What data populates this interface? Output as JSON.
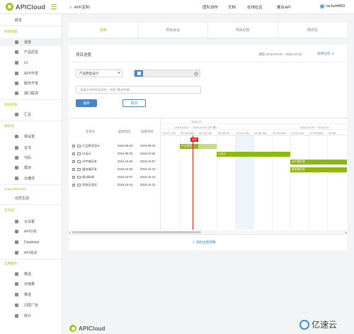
{
  "topbar": {
    "logo_text": "APICloud",
    "chevron": "∨",
    "app_title": "APP定制",
    "nav": [
      "团队协作",
      "文档",
      "在线社区",
      "聚合API"
    ],
    "username": "rachel4869"
  },
  "sidebar": {
    "overview": "概览",
    "sections": [
      {
        "title": "项目管理",
        "items": [
          "进度",
          "产品原型",
          "UI",
          "APP开发",
          "服务开发",
          "接口联调"
        ]
      },
      {
        "title": "测试验收",
        "items": [
          "汇总"
        ]
      },
      {
        "title": "端开发",
        "items": [
          "端设置",
          "证书",
          "代码",
          "模块",
          "云编译"
        ]
      },
      {
        "title": "SuperWebView",
        "items": [
          "动态生成"
        ]
      },
      {
        "title": "云开发",
        "items": [
          "云设置",
          "API分析",
          "Database",
          "API测试"
        ]
      },
      {
        "title": "应用服务",
        "items": [
          "推送",
          "云储量",
          "推送",
          "闪屏广告",
          "统计"
        ]
      }
    ]
  },
  "tabs": [
    {
      "label": "进度",
      "active": true
    },
    {
      "label": "项目会议",
      "active": false
    },
    {
      "label": "项目动态",
      "active": false
    },
    {
      "label": "预评估",
      "active": false
    }
  ],
  "panel": {
    "title": "项目进度",
    "date_range": "进程 2016-09-20 ~ 2016-10-22",
    "new_task": "新建任务",
    "stage_select": "产品原型设计",
    "desc_placeholder": "请填写你的阶段说明，例如 \"需求完善\"",
    "save": "保存",
    "cancel": "取消",
    "collapse": "∨ 收起进度明细"
  },
  "gantt": {
    "headers": {
      "name": "任务名",
      "start": "起始时间",
      "end": "结束时间"
    },
    "year_month": "2016-09",
    "week_range": "2016-09-27 ~ 2016-10-03 (39 周)",
    "week_range_right": "2016-10-03 ~ 2016-10-",
    "days": [
      "09-27,Tue",
      "09-28,Wed",
      "09-29,Thu",
      "09-30,Fri",
      "10-01,Sat",
      "10-02,Sun",
      "10-03,Mon",
      "10-04,Tue",
      "10-05,Wed",
      "10-06"
    ],
    "today_label": "今天",
    "tasks": [
      {
        "name": "产品原型设计",
        "start": "2016-09-20",
        "end": "2016-09-30",
        "bar_label": "产品原型"
      },
      {
        "name": "UI设计",
        "start": "2016-09-30",
        "end": "2016-10-04",
        "bar_label": "UI设计"
      },
      {
        "name": "APP端开发",
        "start": "2016-10-04",
        "end": "2016-10-07",
        "bar_label": "APP端开发"
      },
      {
        "name": "服务端开发",
        "start": "2016-10-04",
        "end": "2016-10-15",
        "bar_label": "服务端开发"
      },
      {
        "name": "接口联调",
        "start": "2016-10-07",
        "end": "2016-10-15",
        "bar_label": ""
      },
      {
        "name": "验收及测试",
        "start": "2016-10-15",
        "end": "2016-10-22",
        "bar_label": ""
      }
    ]
  },
  "footer": {
    "logo_text": "APICloud",
    "watermark": "亿速云"
  },
  "colors": {
    "brand_green": "#a0c41a",
    "primary_blue": "#4a86c5",
    "today_red": "#e02020",
    "bar_green": "#8db80f"
  }
}
